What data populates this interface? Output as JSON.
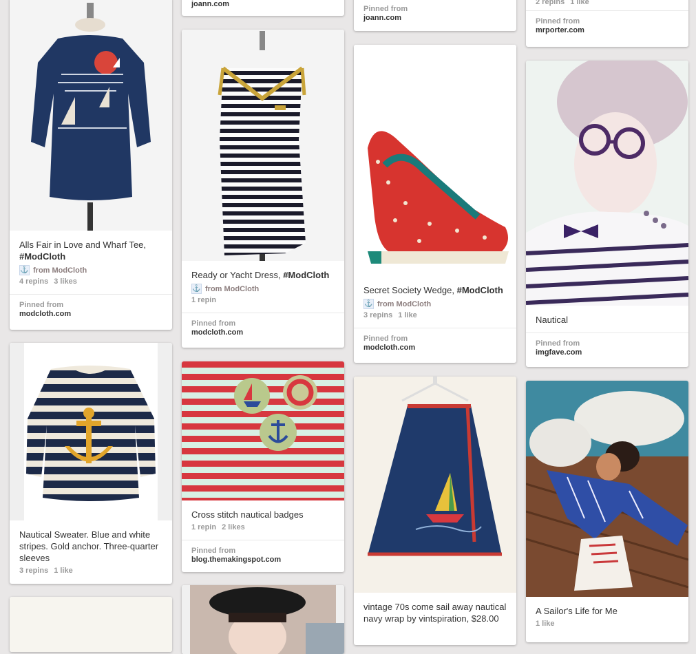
{
  "columns": {
    "c1": [
      {
        "img": "navy-sailboat-tee",
        "desc": "Alls Fair in Love and Wharf Tee, ",
        "tag": "#ModCloth",
        "source": "from ModCloth",
        "stats": [
          "4 repins",
          "3 likes"
        ],
        "pinned_label": "Pinned from",
        "domain": "modcloth.com"
      },
      {
        "img": "striped-anchor-sweater",
        "desc": "Nautical Sweater. Blue and white stripes. Gold anchor. Three-quarter sleeves",
        "stats": [
          "3 repins",
          "1 like"
        ]
      },
      {
        "img": "partial-image"
      }
    ],
    "c2": [
      {
        "domain": "joann.com"
      },
      {
        "img": "striped-yacht-dress",
        "desc": "Ready or Yacht Dress, ",
        "tag": "#ModCloth",
        "source": "from ModCloth",
        "stats": [
          "1 repin"
        ],
        "pinned_label": "Pinned from",
        "domain": "modcloth.com"
      },
      {
        "img": "cross-stitch-badges",
        "desc": "Cross stitch nautical badges",
        "stats": [
          "1 repin",
          "2 likes"
        ],
        "pinned_label": "Pinned from",
        "domain": "blog.themakingspot.com"
      },
      {
        "img": "woman-beret"
      }
    ],
    "c3": [
      {
        "pinned_label": "Pinned from",
        "domain": "joann.com"
      },
      {
        "img": "red-sailboat-wedge",
        "desc": "Secret Society Wedge, ",
        "tag": "#ModCloth",
        "source": "from ModCloth",
        "stats": [
          "3 repins",
          "1 like"
        ],
        "pinned_label": "Pinned from",
        "domain": "modcloth.com"
      },
      {
        "img": "navy-wrap-skirt",
        "desc": "vintage 70s come sail away nautical navy wrap by vintspiration, $28.00"
      }
    ],
    "c4": [
      {
        "stats": [
          "2 repins",
          "1 like"
        ],
        "pinned_label": "Pinned from",
        "domain": "mrporter.com"
      },
      {
        "img": "nautical-woman-glasses",
        "desc": "Nautical",
        "pinned_label": "Pinned from",
        "domain": "imgfave.com"
      },
      {
        "img": "sailor-woman-ropes",
        "desc": "A Sailor's Life for Me",
        "stats": [
          "1 like"
        ]
      }
    ]
  },
  "colors": {
    "background": "#e9e7e7",
    "card": "#ffffff",
    "navy": "#1f3a6b",
    "red": "#d83a33",
    "gold": "#e3a321"
  }
}
